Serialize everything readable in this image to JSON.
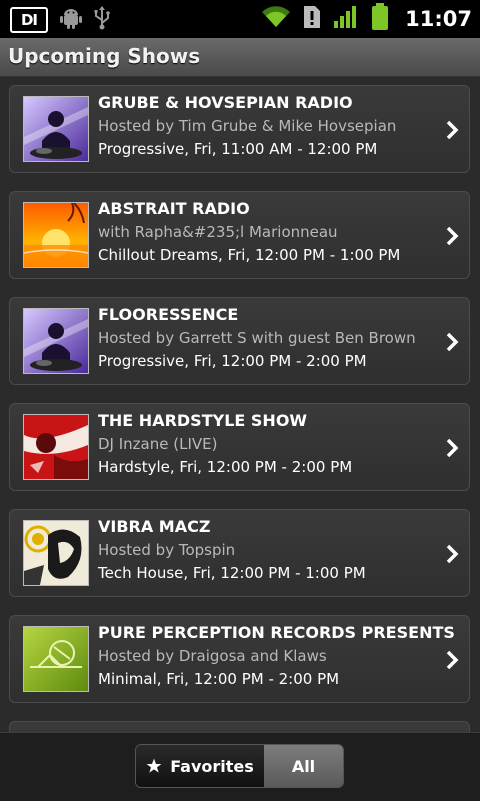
{
  "status_bar": {
    "time": "11:07",
    "logo_text": "DI",
    "icons": [
      "android-icon",
      "usb-icon",
      "wifi-icon",
      "alert-icon",
      "signal-icon",
      "battery-icon"
    ]
  },
  "header": {
    "title": "Upcoming Shows"
  },
  "shows": [
    {
      "title": "GRUBE & HOVSEPIAN RADIO",
      "host": "Hosted by Tim Grube & Mike Hovsepian",
      "time": "Progressive, Fri, 11:00 AM - 12:00 PM",
      "art": "dj-purple"
    },
    {
      "title": "ABSTRAIT RADIO",
      "host": "with Rapha&#235;l Marionneau",
      "time": "Chillout Dreams, Fri, 12:00 PM - 1:00 PM",
      "art": "sunset-orange"
    },
    {
      "title": "FLOORESSENCE",
      "host": "Hosted by Garrett S with guest Ben Brown",
      "time": "Progressive, Fri, 12:00 PM - 2:00 PM",
      "art": "dj-purple"
    },
    {
      "title": "THE HARDSTYLE SHOW",
      "host": "DJ Inzane (LIVE)",
      "time": "Hardstyle, Fri, 12:00 PM - 2:00 PM",
      "art": "red-grunge"
    },
    {
      "title": "VIBRA MACZ",
      "host": "Hosted by Topspin",
      "time": "Tech House, Fri, 12:00 PM - 1:00 PM",
      "art": "bw-face"
    },
    {
      "title": "PURE PERCEPTION RECORDS PRESENTS",
      "host": "Hosted by Draigosa and Klaws",
      "time": "Minimal, Fri, 12:00 PM - 2:00 PM",
      "art": "green-minimal"
    }
  ],
  "bottom": {
    "favorites_label": "Favorites",
    "all_label": "All",
    "selected": "All"
  },
  "colors": {
    "background": "#2b2b2b",
    "card": "#353535",
    "secondary_text": "#b9b9b9"
  }
}
